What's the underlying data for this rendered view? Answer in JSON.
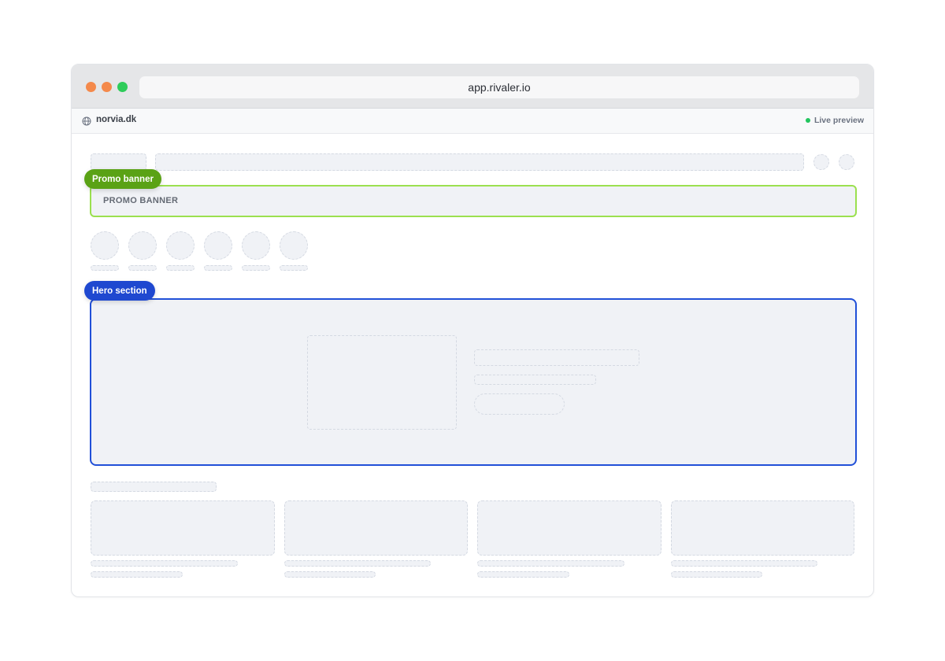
{
  "browser": {
    "url": "app.rivaler.io"
  },
  "site_bar": {
    "site_name": "norvia.dk",
    "globe_icon": "globe-icon",
    "status_label": "Live preview",
    "status_color": "#22c55e"
  },
  "annotations": {
    "promo": {
      "tag_label": "Promo banner",
      "tag_color": "#5aa215",
      "outline_color": "#9be04f",
      "content_label": "PROMO BANNER"
    },
    "hero": {
      "tag_label": "Hero section",
      "tag_color": "#1f48d0",
      "outline_color": "#2150d8"
    }
  }
}
